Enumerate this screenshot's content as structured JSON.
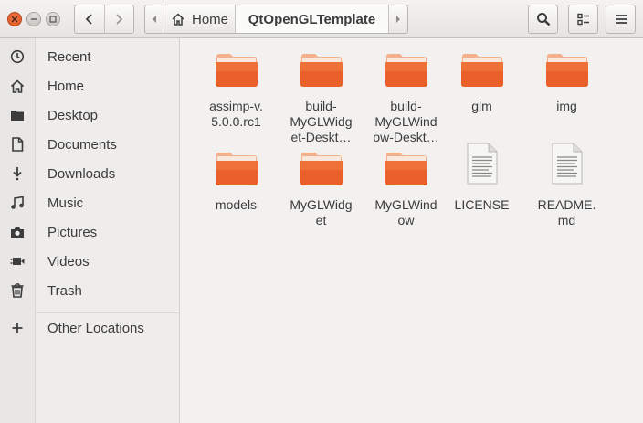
{
  "header": {
    "path_home": "Home",
    "path_current": "QtOpenGLTemplate"
  },
  "sidebar": {
    "items": [
      {
        "label": "Recent",
        "icon": "clock-icon"
      },
      {
        "label": "Home",
        "icon": "home-icon"
      },
      {
        "label": "Desktop",
        "icon": "folder-icon"
      },
      {
        "label": "Documents",
        "icon": "document-icon"
      },
      {
        "label": "Downloads",
        "icon": "download-icon"
      },
      {
        "label": "Music",
        "icon": "music-icon"
      },
      {
        "label": "Pictures",
        "icon": "camera-icon"
      },
      {
        "label": "Videos",
        "icon": "video-icon"
      },
      {
        "label": "Trash",
        "icon": "trash-icon"
      },
      {
        "label": "Other Locations",
        "icon": "plus-icon"
      }
    ]
  },
  "files": [
    {
      "name": "assimp-v.\n5.0.0.rc1",
      "type": "folder"
    },
    {
      "name": "build-\nMyGLWidg\net-Deskt…",
      "type": "folder"
    },
    {
      "name": "build-\nMyGLWind\now-Deskt…",
      "type": "folder"
    },
    {
      "name": "glm",
      "type": "folder"
    },
    {
      "name": "img",
      "type": "folder"
    },
    {
      "name": "models",
      "type": "folder"
    },
    {
      "name": "MyGLWidg\net",
      "type": "folder"
    },
    {
      "name": "MyGLWind\now",
      "type": "folder"
    },
    {
      "name": "LICENSE",
      "type": "text-file"
    },
    {
      "name": "README.\nmd",
      "type": "text-file"
    }
  ],
  "colors": {
    "folder_top": "#f7a27a",
    "folder_body": "#e9602a",
    "close_button": "#e95420"
  }
}
